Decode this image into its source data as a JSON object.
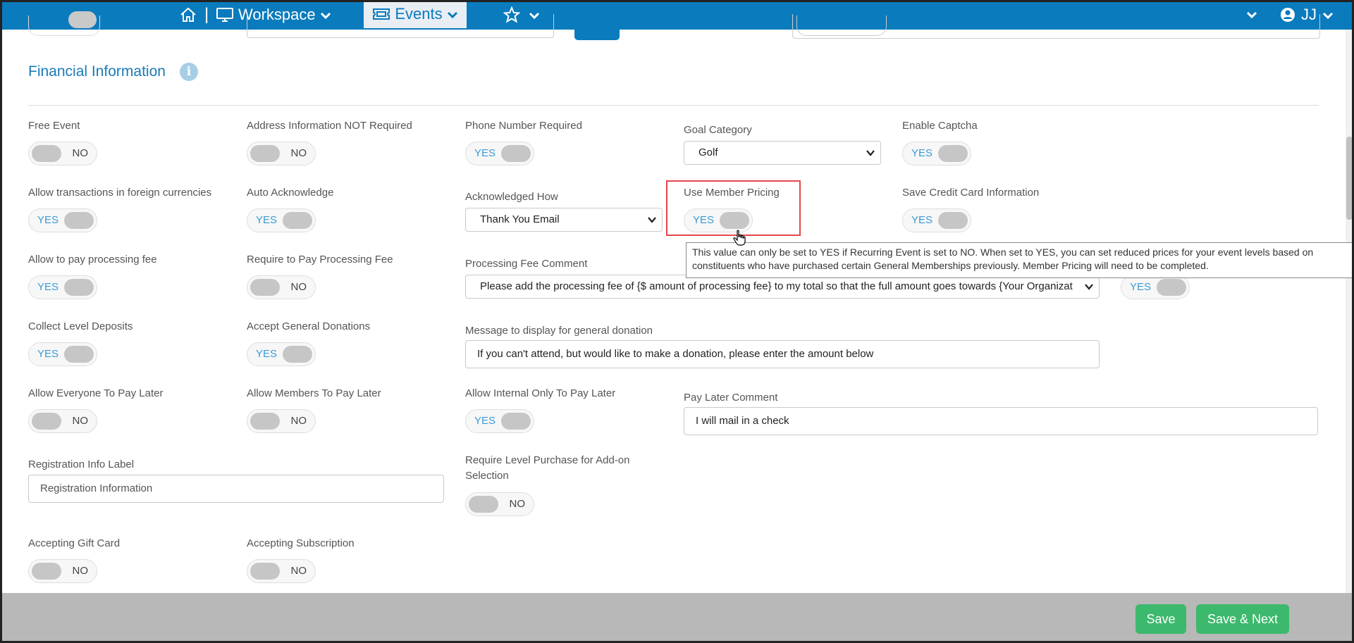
{
  "nav": {
    "separator": "|",
    "workspace_label": "Workspace",
    "events_label": "Events",
    "user_initials": "JJ"
  },
  "section": {
    "title": "Financial Information"
  },
  "fields": {
    "free_event": {
      "label": "Free Event",
      "value": "NO"
    },
    "address_not_required": {
      "label": "Address Information NOT Required",
      "value": "NO"
    },
    "phone_required": {
      "label": "Phone Number Required",
      "value": "YES"
    },
    "goal_category": {
      "label": "Goal Category",
      "value": "Golf"
    },
    "enable_captcha": {
      "label": "Enable Captcha",
      "value": "YES"
    },
    "foreign_currencies": {
      "label": "Allow transactions in foreign currencies",
      "value": "YES"
    },
    "auto_acknowledge": {
      "label": "Auto Acknowledge",
      "value": "YES"
    },
    "acknowledged_how": {
      "label": "Acknowledged How",
      "value": "Thank You Email"
    },
    "use_member_pricing": {
      "label": "Use Member Pricing",
      "value": "YES"
    },
    "save_credit_card": {
      "label": "Save Credit Card Information",
      "value": "YES"
    },
    "pay_processing_fee": {
      "label": "Allow to pay processing fee",
      "value": "YES"
    },
    "require_processing_fee": {
      "label": "Require to Pay Processing Fee",
      "value": "NO"
    },
    "processing_fee_comment": {
      "label": "Processing Fee Comment",
      "value": "Please add the processing fee of {$ amount of processing fee} to my total so that the full amount goes towards {Your Organizat"
    },
    "hidden_toggle": {
      "value": "YES"
    },
    "collect_level_deposits": {
      "label": "Collect Level Deposits",
      "value": "YES"
    },
    "accept_general_donations": {
      "label": "Accept General Donations",
      "value": "YES"
    },
    "general_donation_message": {
      "label": "Message to display for general donation",
      "value": "If you can't attend, but would like to make a donation, please enter the amount below"
    },
    "everyone_pay_later": {
      "label": "Allow Everyone To Pay Later",
      "value": "NO"
    },
    "members_pay_later": {
      "label": "Allow Members To Pay Later",
      "value": "NO"
    },
    "internal_pay_later": {
      "label": "Allow Internal Only To Pay Later",
      "value": "YES"
    },
    "pay_later_comment": {
      "label": "Pay Later Comment",
      "value": "I will mail in a check"
    },
    "registration_info_label": {
      "label": "Registration Info Label",
      "placeholder": "Registration Information"
    },
    "require_level_purchase": {
      "label_line1": "Require Level Purchase for Add-on",
      "label_line2": "Selection",
      "value": "NO"
    },
    "accepting_gift_card": {
      "label": "Accepting Gift Card",
      "value": "NO"
    },
    "accepting_subscription": {
      "label": "Accepting Subscription",
      "value": "NO"
    }
  },
  "tooltip": {
    "line1": "This value can only be set to YES if Recurring Event is set to NO.  When set to YES, you can set reduced prices for your event levels based on",
    "line2": "constituents who have purchased certain General Memberships previously.  Member Pricing will need to be completed."
  },
  "footer": {
    "save_label": "Save",
    "save_next_label": "Save & Next"
  },
  "colors": {
    "nav_bg": "#0a7bbd",
    "accent": "#1a7ab7",
    "yes_text": "#3a9bd6",
    "button_green": "#3cb96c",
    "highlight_red": "#e5474b"
  }
}
